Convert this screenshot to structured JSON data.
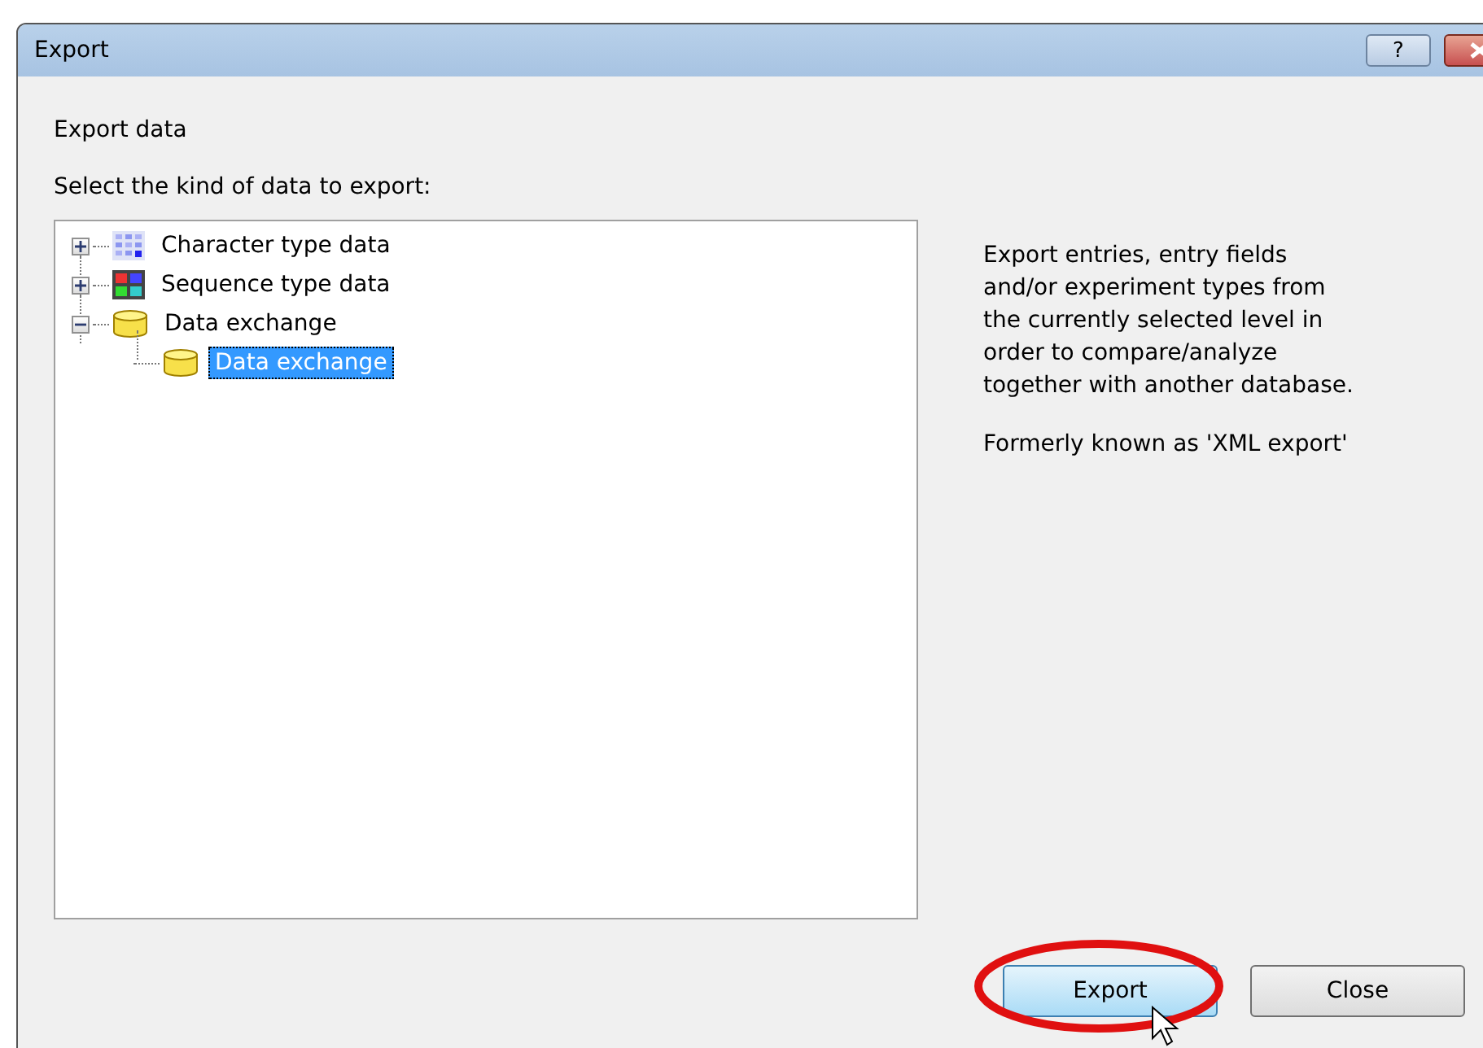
{
  "window": {
    "title": "Export",
    "help_button": "?"
  },
  "heading": "Export data",
  "prompt": "Select the kind of data to export:",
  "tree": [
    {
      "label": "Character type data",
      "kind": "matrix",
      "expanded": false,
      "selected": false
    },
    {
      "label": "Sequence type data",
      "kind": "sequence",
      "expanded": false,
      "selected": false
    },
    {
      "label": "Data exchange",
      "kind": "database",
      "expanded": true,
      "selected": false,
      "children": [
        {
          "label": "Data exchange",
          "kind": "database",
          "selected": true
        }
      ]
    }
  ],
  "description": [
    "Export entries, entry fields and/or experiment types from the currently selected level in order to compare/analyze together with another database.",
    "Formerly known as 'XML export'"
  ],
  "buttons": [
    {
      "label": "Export",
      "kind": "primary",
      "highlighted": true
    },
    {
      "label": "Close",
      "kind": "normal",
      "highlighted": false
    }
  ]
}
